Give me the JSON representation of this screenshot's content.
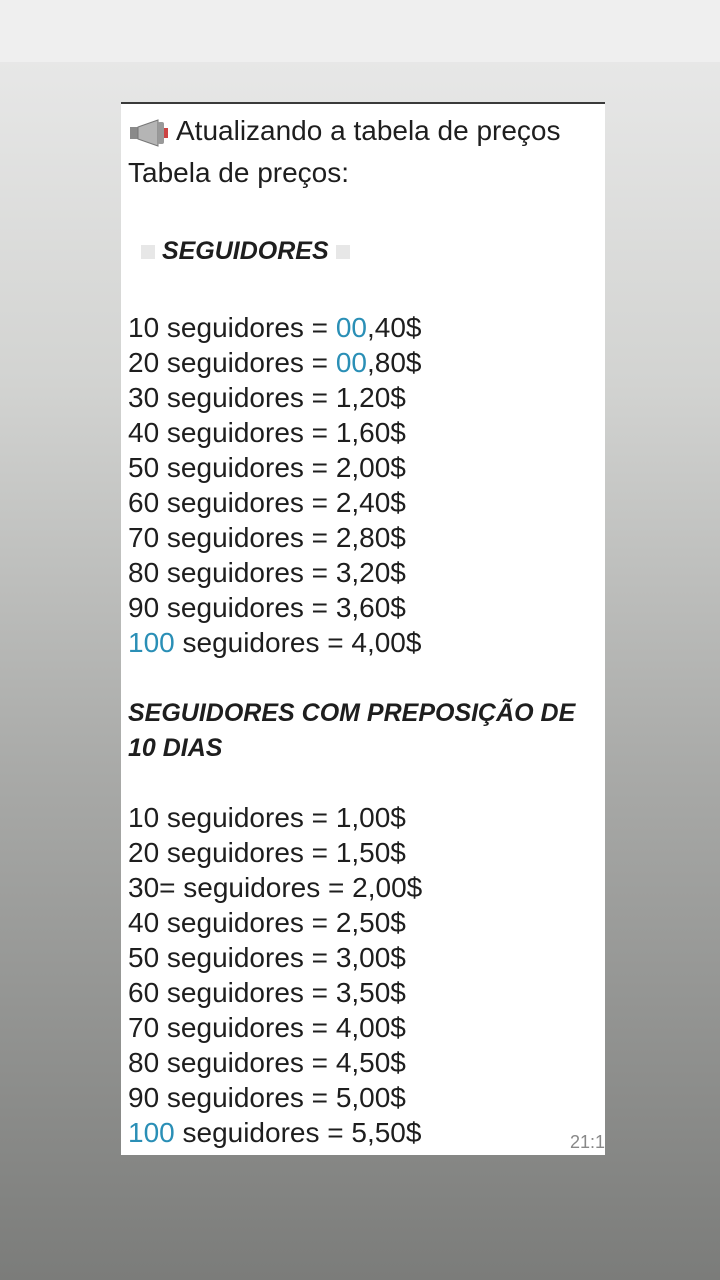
{
  "header": {
    "announcement": "Atualizando a tabela de preços",
    "subtitle": "Tabela de preços:",
    "icon": "megaphone-icon"
  },
  "section1": {
    "title": "SEGUIDORES",
    "rows": [
      {
        "pre": "10 seguidores = ",
        "hl": "00",
        "post": ",40$"
      },
      {
        "pre": "20 seguidores = ",
        "hl": "00",
        "post": ",80$"
      },
      {
        "pre": "30 seguidores = 1,20$",
        "hl": "",
        "post": ""
      },
      {
        "pre": "40 seguidores = 1,60$",
        "hl": "",
        "post": ""
      },
      {
        "pre": "50 seguidores = 2,00$",
        "hl": "",
        "post": ""
      },
      {
        "pre": "60 seguidores = 2,40$",
        "hl": "",
        "post": ""
      },
      {
        "pre": "70 seguidores = 2,80$",
        "hl": "",
        "post": ""
      },
      {
        "pre": "80 seguidores = 3,20$",
        "hl": "",
        "post": ""
      },
      {
        "pre": "90 seguidores = 3,60$",
        "hl": "",
        "post": ""
      },
      {
        "pre": "",
        "hl": "100",
        "post": " seguidores = 4,00$"
      }
    ]
  },
  "section2": {
    "title_line1": "SEGUIDORES COM PREPOSIÇÃO DE",
    "title_line2": "10 DIAS",
    "rows": [
      {
        "pre": "10 seguidores = 1,00$",
        "hl": "",
        "post": ""
      },
      {
        "pre": "20 seguidores = 1,50$",
        "hl": "",
        "post": ""
      },
      {
        "pre": "30= seguidores = 2,00$",
        "hl": "",
        "post": ""
      },
      {
        "pre": "40 seguidores = 2,50$",
        "hl": "",
        "post": ""
      },
      {
        "pre": "50 seguidores = 3,00$",
        "hl": "",
        "post": ""
      },
      {
        "pre": "60 seguidores = 3,50$",
        "hl": "",
        "post": ""
      },
      {
        "pre": "70 seguidores = 4,00$",
        "hl": "",
        "post": ""
      },
      {
        "pre": "80 seguidores = 4,50$",
        "hl": "",
        "post": ""
      },
      {
        "pre": "90 seguidores = 5,00$",
        "hl": "",
        "post": ""
      },
      {
        "pre": "",
        "hl": "100",
        "post": " seguidores = 5,50$"
      }
    ]
  },
  "timestamp": "21:1",
  "colors": {
    "highlight": "#2a8fb6",
    "text": "#1e1e1e"
  }
}
